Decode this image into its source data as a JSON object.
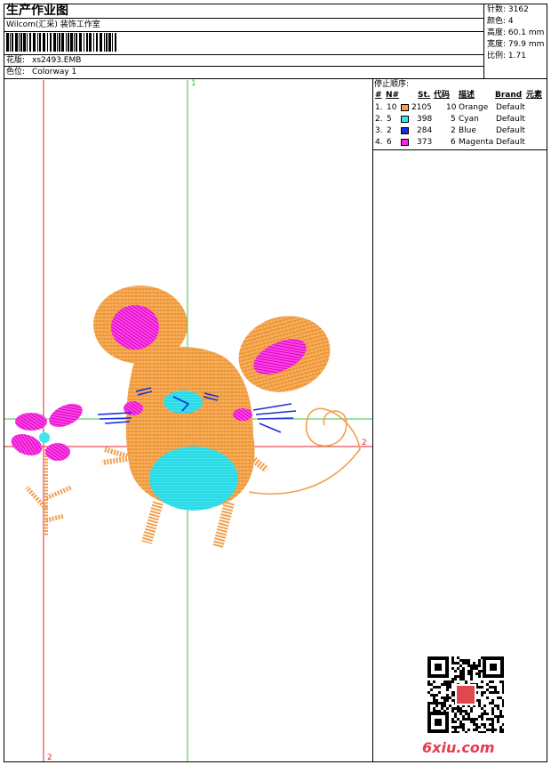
{
  "header": {
    "title": "生产作业图",
    "studio": "Wilcom(汇采) 装饰工作室",
    "design_label": "花版:",
    "design_value": "xs2493.EMB",
    "colorway_label": "色位:",
    "colorway_value": "Colorway 1"
  },
  "stats": [
    {
      "label": "针数:",
      "value": "3162"
    },
    {
      "label": "颜色:",
      "value": "4"
    },
    {
      "label": "高度:",
      "value": "60.1 mm"
    },
    {
      "label": "宽度:",
      "value": "79.9 mm"
    },
    {
      "label": "比例:",
      "value": "1.71"
    }
  ],
  "stop_sequence": {
    "title": "停止顺序:",
    "headers": [
      "#",
      "N#",
      "St.",
      "代码",
      "描述",
      "Brand",
      "元素"
    ],
    "rows": [
      {
        "idx": "1.",
        "n": "10",
        "color": "#f7a04a",
        "st": "2105",
        "code": "10",
        "desc": "Orange",
        "brand": "Default"
      },
      {
        "idx": "2.",
        "n": "5",
        "color": "#33e5ee",
        "st": "398",
        "code": "5",
        "desc": "Cyan",
        "brand": "Default"
      },
      {
        "idx": "3.",
        "n": "2",
        "color": "#1a2fd6",
        "st": "284",
        "code": "2",
        "desc": "Blue",
        "brand": "Default"
      },
      {
        "idx": "4.",
        "n": "6",
        "color": "#ff22e0",
        "st": "373",
        "code": "6",
        "desc": "Magenta",
        "brand": "Default"
      }
    ]
  },
  "canvas": {
    "axis_labels": {
      "green_top": "1",
      "red_right": "2",
      "red_bottom": "2"
    },
    "guide_colors": {
      "red": "#e4232b",
      "green": "#37c83a"
    }
  },
  "watermark": {
    "logo": "6xiu.com"
  }
}
